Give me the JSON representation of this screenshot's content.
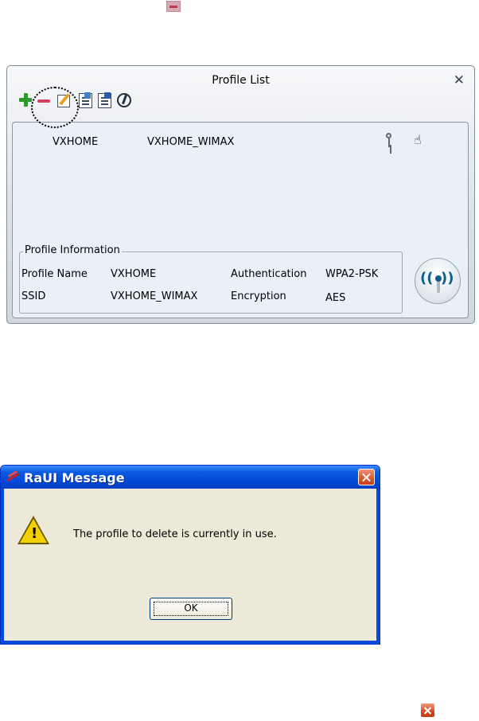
{
  "profile_list": {
    "title": "Profile List",
    "close_symbol": "✕",
    "toolbar": [
      "add-icon",
      "delete-icon",
      "edit-icon",
      "import-icon",
      "export-icon",
      "connect-icon"
    ],
    "profiles": [
      {
        "name": "VXHOME",
        "ssid": "VXHOME_WIMAX",
        "status_icons": [
          "key-icon",
          "hand-pointer-icon"
        ]
      }
    ],
    "info": {
      "legend": "Profile Information",
      "profile_name_label": "Profile Name",
      "profile_name_value": "VXHOME",
      "ssid_label": "SSID",
      "ssid_value": "VXHOME_WIMAX",
      "auth_label": "Authentication",
      "auth_value": "WPA2-PSK",
      "enc_label": "Encryption",
      "enc_value": "AES"
    },
    "wifi_arcs": {
      "left": "((",
      "right": "))"
    }
  },
  "message": {
    "title": "RaUI Message",
    "icon": "warning-icon",
    "text": "The profile to delete is currently in use.",
    "ok_label": "OK"
  },
  "hand_glyph": "☝",
  "warn_glyph": "!",
  "colors": {
    "xp_title": "#0047d4",
    "panel": "#e8f0f8",
    "dialog_bg": "#ece9d8"
  }
}
